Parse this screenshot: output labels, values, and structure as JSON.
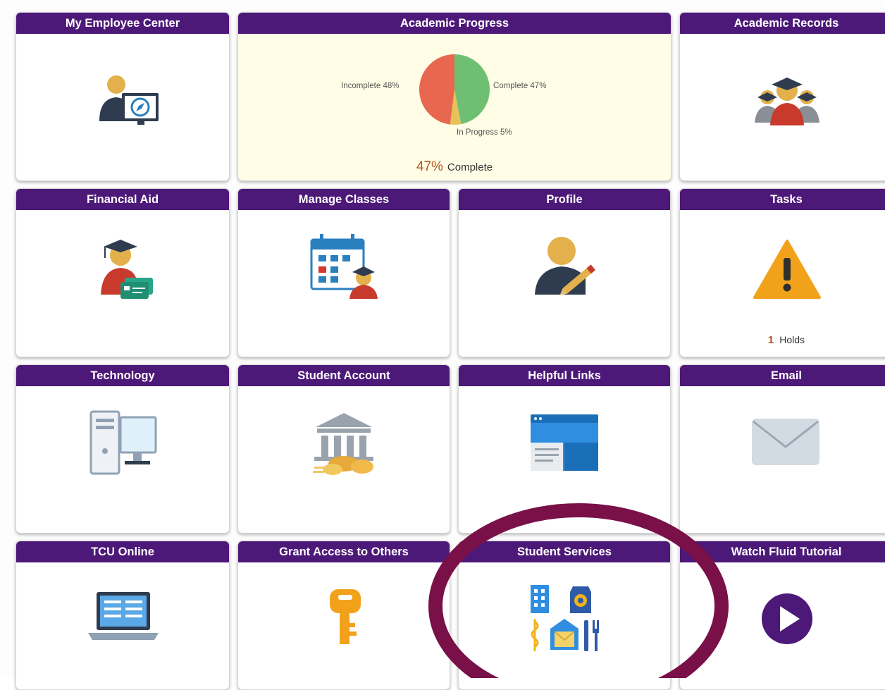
{
  "tiles": {
    "my_employee_center": {
      "title": "My Employee Center",
      "icon": "employee-monitor-icon"
    },
    "academic_progress": {
      "title": "Academic Progress",
      "icon": "pie-chart-icon",
      "summary_percent": "47%",
      "summary_label": "Complete"
    },
    "academic_records": {
      "title": "Academic Records",
      "icon": "graduates-icon"
    },
    "financial_aid": {
      "title": "Financial Aid",
      "icon": "graduate-card-icon"
    },
    "manage_classes": {
      "title": "Manage Classes",
      "icon": "calendar-student-icon"
    },
    "profile": {
      "title": "Profile",
      "icon": "user-edit-icon"
    },
    "tasks": {
      "title": "Tasks",
      "icon": "warning-icon",
      "holds_count": "1",
      "holds_label": "Holds"
    },
    "technology": {
      "title": "Technology",
      "icon": "desktop-computer-icon"
    },
    "student_account": {
      "title": "Student Account",
      "icon": "bank-coins-icon"
    },
    "helpful_links": {
      "title": "Helpful Links",
      "icon": "browser-window-icon"
    },
    "email": {
      "title": "Email",
      "icon": "envelope-icon"
    },
    "tcu_online": {
      "title": "TCU Online",
      "icon": "laptop-icon"
    },
    "grant_access": {
      "title": "Grant Access to Others",
      "icon": "key-icon"
    },
    "student_services": {
      "title": "Student Services",
      "icon": "campus-services-icon"
    },
    "watch_fluid_tutorial": {
      "title": "Watch Fluid Tutorial",
      "icon": "play-icon"
    }
  },
  "chart_data": {
    "type": "pie",
    "slices": [
      {
        "label": "Complete 47%",
        "value": 47,
        "color": "#6fbf73"
      },
      {
        "label": "In Progress 5%",
        "value": 5,
        "color": "#e8c15a"
      },
      {
        "label": "Incomplete 48%",
        "value": 48,
        "color": "#e8674f"
      }
    ]
  },
  "colors": {
    "header_purple": "#4d1979",
    "highlight_ring": "#7a1048",
    "accent_orange": "#b5531b"
  }
}
